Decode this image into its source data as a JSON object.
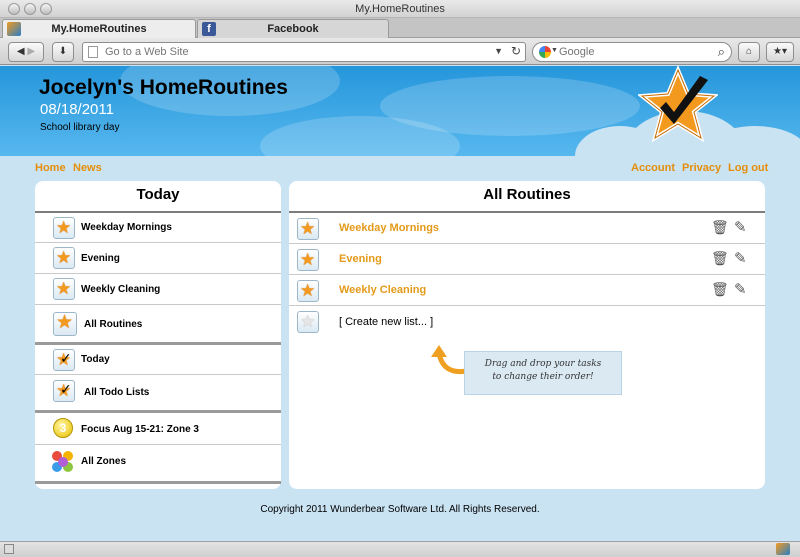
{
  "window": {
    "title": "My.HomeRoutines"
  },
  "tabs": [
    {
      "label": "My.HomeRoutines",
      "active": true
    },
    {
      "label": "Facebook",
      "active": false
    }
  ],
  "toolbar": {
    "url_placeholder": "Go to a Web Site",
    "search_placeholder": "Google"
  },
  "header": {
    "title": "Jocelyn's HomeRoutines",
    "date": "08/18/2011",
    "subtitle": "School library day"
  },
  "nav": {
    "left": [
      "Home",
      "News"
    ],
    "right": [
      "Account",
      "Privacy",
      "Log out"
    ]
  },
  "today_panel": {
    "title": "Today",
    "routines": [
      "Weekday Mornings",
      "Evening",
      "Weekly Cleaning",
      "All Routines"
    ],
    "todos": [
      "Today",
      "All Todo Lists"
    ],
    "zones": [
      "Focus Aug 15-21: Zone 3",
      "All Zones"
    ],
    "zone_number": "3"
  },
  "routines_panel": {
    "title": "All Routines",
    "items": [
      "Weekday Mornings",
      "Evening",
      "Weekly Cleaning"
    ],
    "create_label": "[ Create new list... ]",
    "hint_line1": "Drag and drop your tasks",
    "hint_line2": "to change their order!"
  },
  "footer": {
    "copyright": "Copyright 2011 Wunderbear Software Ltd. All Rights Reserved."
  },
  "colors": {
    "accent": "#e58e0c",
    "header_blue": "#2596db",
    "page_bg": "#c9e3f3"
  },
  "icons": {
    "star": "star-icon",
    "check": "checkmark-icon",
    "trash": "trash-icon",
    "pencil": "pencil-icon"
  }
}
